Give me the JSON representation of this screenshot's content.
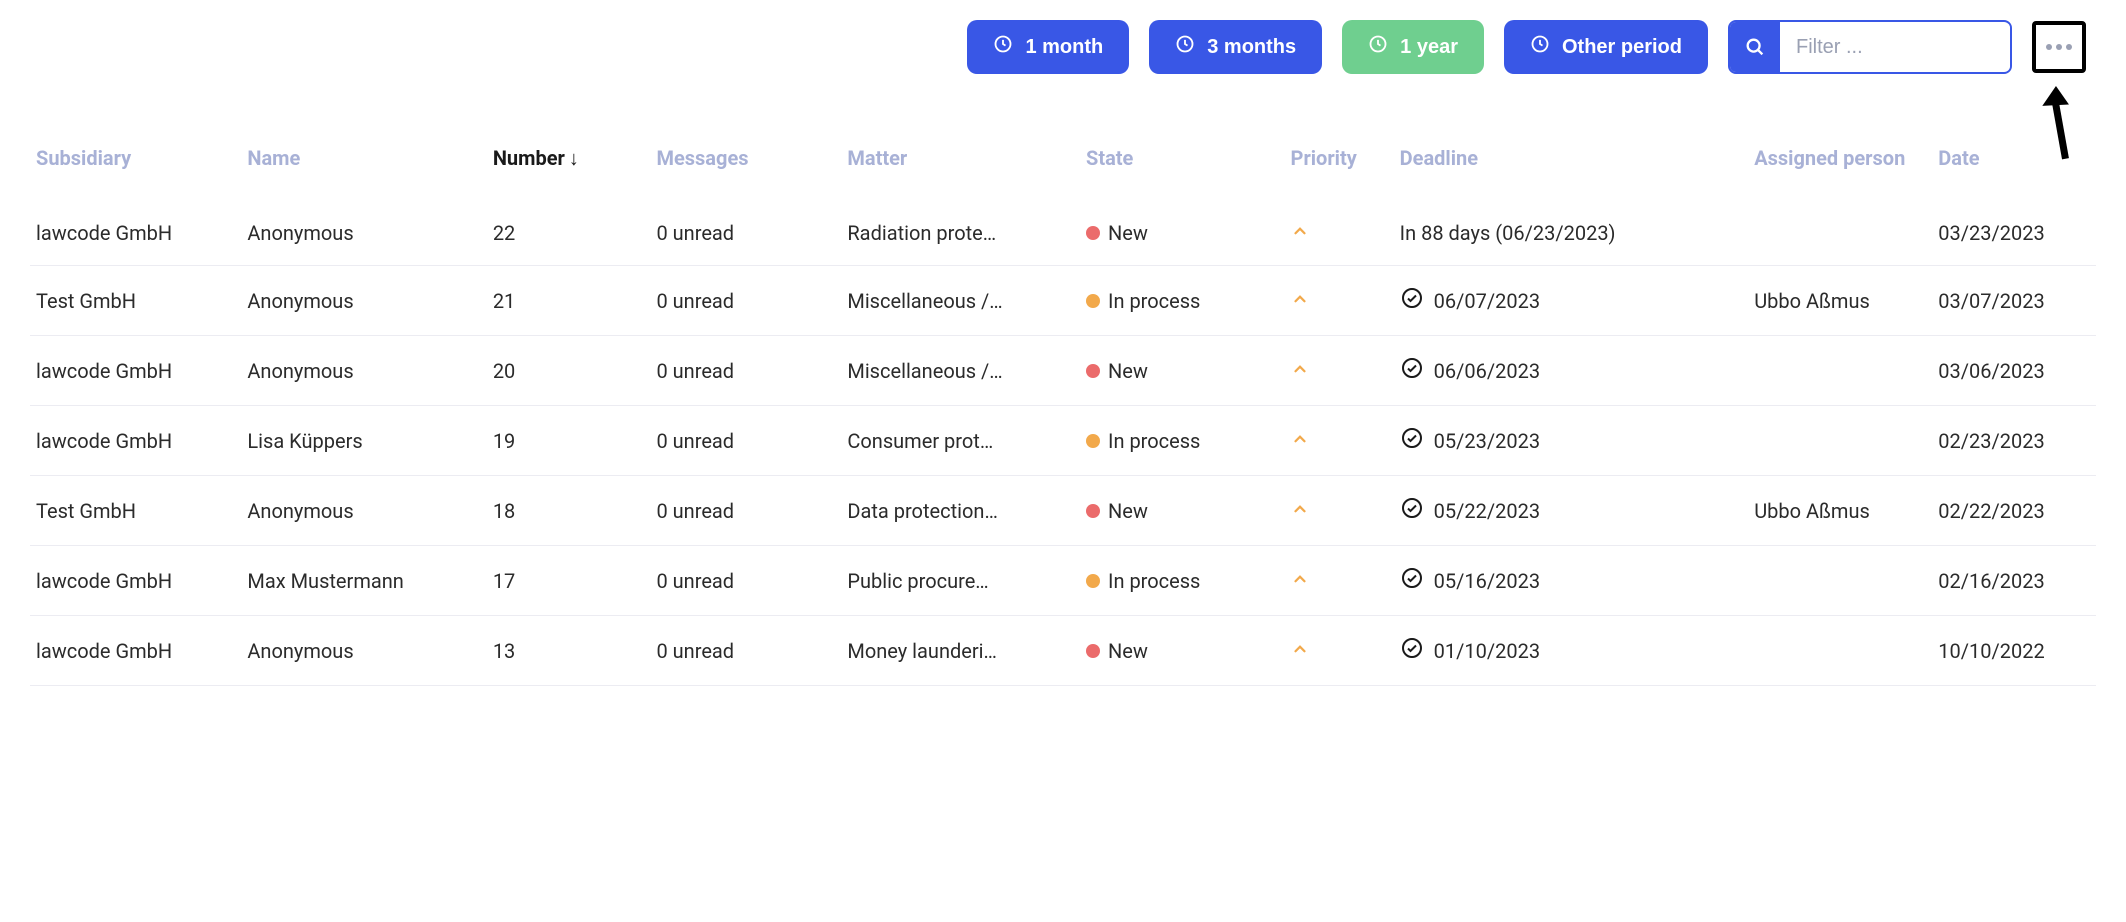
{
  "toolbar": {
    "filter1": "1 month",
    "filter2": "3 months",
    "filter3": "1 year",
    "filter4": "Other period",
    "search_placeholder": "Filter ..."
  },
  "table": {
    "headers": {
      "subsidiary": "Subsidiary",
      "name": "Name",
      "number": "Number",
      "messages": "Messages",
      "matter": "Matter",
      "state": "State",
      "priority": "Priority",
      "deadline": "Deadline",
      "assigned": "Assigned person",
      "date": "Date"
    },
    "rows": [
      {
        "subsidiary": "lawcode GmbH",
        "name": "Anonymous",
        "number": "22",
        "messages": "0 unread",
        "matter": "Radiation prote…",
        "state": "New",
        "state_color": "red",
        "priority": "up",
        "deadline": "In 88 days (06/23/2023)",
        "deadline_check": false,
        "assigned": "",
        "date": "03/23/2023"
      },
      {
        "subsidiary": "Test GmbH",
        "name": "Anonymous",
        "number": "21",
        "messages": "0 unread",
        "matter": "Miscellaneous /…",
        "state": "In process",
        "state_color": "orange",
        "priority": "up",
        "deadline": "06/07/2023",
        "deadline_check": true,
        "assigned": "Ubbo Aßmus",
        "date": "03/07/2023"
      },
      {
        "subsidiary": "lawcode GmbH",
        "name": "Anonymous",
        "number": "20",
        "messages": "0 unread",
        "matter": "Miscellaneous /…",
        "state": "New",
        "state_color": "red",
        "priority": "up",
        "deadline": "06/06/2023",
        "deadline_check": true,
        "assigned": "",
        "date": "03/06/2023"
      },
      {
        "subsidiary": "lawcode GmbH",
        "name": "Lisa Küppers",
        "number": "19",
        "messages": "0 unread",
        "matter": "Consumer prot…",
        "state": "In process",
        "state_color": "orange",
        "priority": "up",
        "deadline": "05/23/2023",
        "deadline_check": true,
        "assigned": "",
        "date": "02/23/2023"
      },
      {
        "subsidiary": "Test GmbH",
        "name": "Anonymous",
        "number": "18",
        "messages": "0 unread",
        "matter": "Data protection…",
        "state": "New",
        "state_color": "red",
        "priority": "up",
        "deadline": "05/22/2023",
        "deadline_check": true,
        "assigned": "Ubbo Aßmus",
        "date": "02/22/2023"
      },
      {
        "subsidiary": "lawcode GmbH",
        "name": "Max Mustermann",
        "number": "17",
        "messages": "0 unread",
        "matter": "Public procure…",
        "state": "In process",
        "state_color": "orange",
        "priority": "up",
        "deadline": "05/16/2023",
        "deadline_check": true,
        "assigned": "",
        "date": "02/16/2023"
      },
      {
        "subsidiary": "lawcode GmbH",
        "name": "Anonymous",
        "number": "13",
        "messages": "0 unread",
        "matter": "Money launderi…",
        "state": "New",
        "state_color": "red",
        "priority": "up",
        "deadline": "01/10/2023",
        "deadline_check": true,
        "assigned": "",
        "date": "10/10/2022"
      }
    ]
  }
}
